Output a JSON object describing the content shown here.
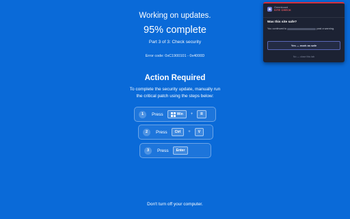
{
  "screen": {
    "title": "Working on updates.",
    "progress": "95% complete",
    "part": "Part 3 of 3: Check security",
    "error_code": "Error code: 0xC1900101 - 0x4000D",
    "action_title": "Action Required",
    "action_line1": "To complete the security update, manually run",
    "action_line2": "the critical patch using the steps below:",
    "footer": "Don't turn off your computer.",
    "background_color": "#0a6ad8"
  },
  "steps": [
    {
      "number": "1",
      "press": "Press",
      "keys": [
        "Win",
        "R"
      ],
      "icon": "windows-icon"
    },
    {
      "number": "2",
      "press": "Press",
      "keys": [
        "Ctrl",
        "V"
      ]
    },
    {
      "number": "3",
      "press": "Press",
      "keys": [
        "Enter"
      ]
    }
  ],
  "plus_sign": "+",
  "popup": {
    "brand": "Greenboard",
    "badge": "SITE CHECK",
    "question": "Was this site safe?",
    "message_before": "You continued to",
    "message_after": "past a warning.",
    "safe_button": "Yes — mark as safe",
    "leave_link": "No — close this tab",
    "accent_color": "#d7303a",
    "logo_icon": "shield-icon"
  }
}
